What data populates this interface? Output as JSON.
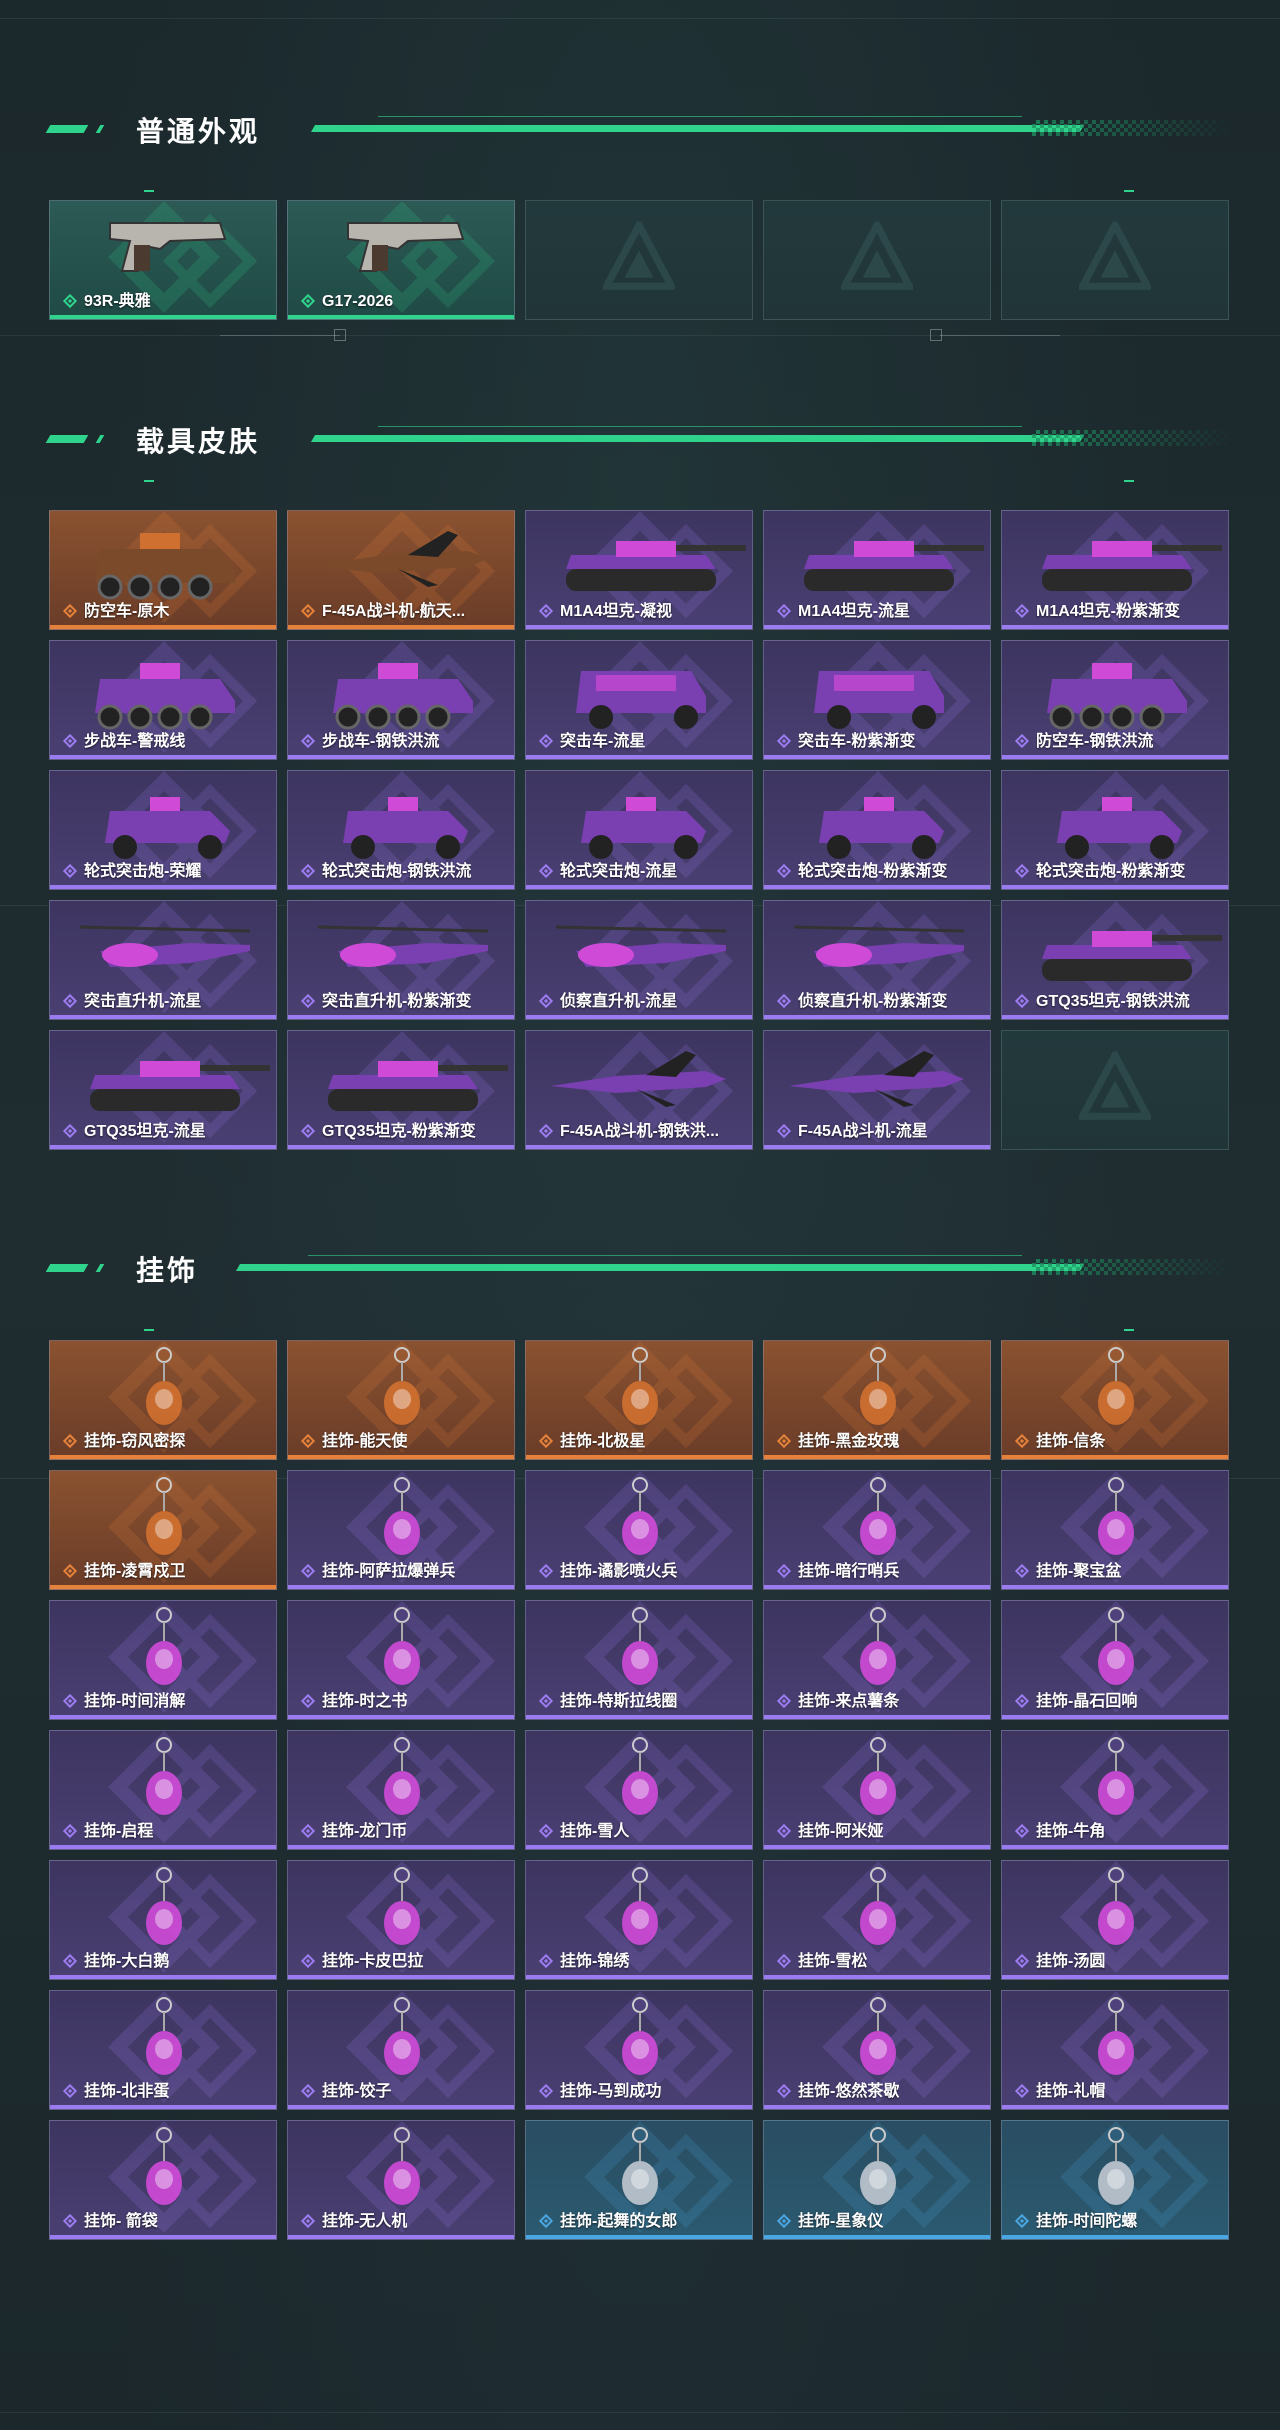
{
  "sections": {
    "normal": {
      "title": "普通外观"
    },
    "vehicle": {
      "title": "载具皮肤"
    },
    "charm": {
      "title": "挂饰"
    }
  },
  "rarity_colors": {
    "green": "#2fd38c",
    "orange": "#e5813a",
    "purple": "#9b7cf0",
    "blue": "#4aa6e0"
  },
  "normal_items": [
    {
      "label": "93R-典雅",
      "rarity": "green",
      "icon": "pistol-icon"
    },
    {
      "label": "G17-2026",
      "rarity": "green",
      "icon": "pistol-icon"
    },
    {
      "label": "",
      "rarity": "empty",
      "icon": "logo-watermark-icon"
    },
    {
      "label": "",
      "rarity": "empty",
      "icon": "logo-watermark-icon"
    },
    {
      "label": "",
      "rarity": "empty",
      "icon": "logo-watermark-icon"
    }
  ],
  "vehicle_items": [
    {
      "label": "防空车-原木",
      "rarity": "orange",
      "icon": "armored-car-icon"
    },
    {
      "label": "F-45A战斗机-航天...",
      "rarity": "orange",
      "icon": "jet-icon"
    },
    {
      "label": "M1A4坦克-凝视",
      "rarity": "purple",
      "icon": "tank-icon"
    },
    {
      "label": "M1A4坦克-流星",
      "rarity": "purple",
      "icon": "tank-icon"
    },
    {
      "label": "M1A4坦克-粉紫渐变",
      "rarity": "purple",
      "icon": "tank-icon"
    },
    {
      "label": "步战车-警戒线",
      "rarity": "purple",
      "icon": "armored-car-icon"
    },
    {
      "label": "步战车-钢铁洪流",
      "rarity": "purple",
      "icon": "armored-car-icon"
    },
    {
      "label": "突击车-流星",
      "rarity": "purple",
      "icon": "jeep-icon"
    },
    {
      "label": "突击车-粉紫渐变",
      "rarity": "purple",
      "icon": "jeep-icon"
    },
    {
      "label": "防空车-钢铁洪流",
      "rarity": "purple",
      "icon": "armored-car-icon"
    },
    {
      "label": "轮式突击炮-荣耀",
      "rarity": "purple",
      "icon": "buggy-icon"
    },
    {
      "label": "轮式突击炮-钢铁洪流",
      "rarity": "purple",
      "icon": "buggy-icon"
    },
    {
      "label": "轮式突击炮-流星",
      "rarity": "purple",
      "icon": "buggy-icon"
    },
    {
      "label": "轮式突击炮-粉紫渐变",
      "rarity": "purple",
      "icon": "buggy-icon"
    },
    {
      "label": "轮式突击炮-粉紫渐变",
      "rarity": "purple",
      "icon": "buggy-icon"
    },
    {
      "label": "突击直升机-流星",
      "rarity": "purple",
      "icon": "helicopter-icon"
    },
    {
      "label": "突击直升机-粉紫渐变",
      "rarity": "purple",
      "icon": "helicopter-icon"
    },
    {
      "label": "侦察直升机-流星",
      "rarity": "purple",
      "icon": "helicopter-icon"
    },
    {
      "label": "侦察直升机-粉紫渐变",
      "rarity": "purple",
      "icon": "helicopter-icon"
    },
    {
      "label": "GTQ35坦克-钢铁洪流",
      "rarity": "purple",
      "icon": "tank-icon"
    },
    {
      "label": "GTQ35坦克-流星",
      "rarity": "purple",
      "icon": "tank-icon"
    },
    {
      "label": "GTQ35坦克-粉紫渐变",
      "rarity": "purple",
      "icon": "tank-icon"
    },
    {
      "label": "F-45A战斗机-钢铁洪...",
      "rarity": "purple",
      "icon": "jet-icon"
    },
    {
      "label": "F-45A战斗机-流星",
      "rarity": "purple",
      "icon": "jet-icon"
    },
    {
      "label": "",
      "rarity": "empty",
      "icon": "logo-watermark-icon"
    }
  ],
  "charm_items": [
    {
      "label": "挂饰-窃风密探",
      "rarity": "orange",
      "icon": "charm-icon"
    },
    {
      "label": "挂饰-能天使",
      "rarity": "orange",
      "icon": "charm-icon"
    },
    {
      "label": "挂饰-北极星",
      "rarity": "orange",
      "icon": "charm-icon"
    },
    {
      "label": "挂饰-黑金玫瑰",
      "rarity": "orange",
      "icon": "charm-icon"
    },
    {
      "label": "挂饰-信条",
      "rarity": "orange",
      "icon": "charm-icon"
    },
    {
      "label": "挂饰-凌霄戍卫",
      "rarity": "orange",
      "icon": "charm-icon"
    },
    {
      "label": "挂饰-阿萨拉爆弹兵",
      "rarity": "purple",
      "icon": "charm-icon"
    },
    {
      "label": "挂饰-谲影喷火兵",
      "rarity": "purple",
      "icon": "charm-icon"
    },
    {
      "label": "挂饰-暗行哨兵",
      "rarity": "purple",
      "icon": "charm-icon"
    },
    {
      "label": "挂饰-聚宝盆",
      "rarity": "purple",
      "icon": "charm-icon"
    },
    {
      "label": "挂饰-时间消解",
      "rarity": "purple",
      "icon": "charm-icon"
    },
    {
      "label": "挂饰-时之书",
      "rarity": "purple",
      "icon": "charm-icon"
    },
    {
      "label": "挂饰-特斯拉线圈",
      "rarity": "purple",
      "icon": "charm-icon"
    },
    {
      "label": "挂饰-来点薯条",
      "rarity": "purple",
      "icon": "charm-icon"
    },
    {
      "label": "挂饰-晶石回响",
      "rarity": "purple",
      "icon": "charm-icon"
    },
    {
      "label": "挂饰-启程",
      "rarity": "purple",
      "icon": "charm-icon"
    },
    {
      "label": "挂饰-龙门币",
      "rarity": "purple",
      "icon": "charm-icon"
    },
    {
      "label": "挂饰-雪人",
      "rarity": "purple",
      "icon": "charm-icon"
    },
    {
      "label": "挂饰-阿米娅",
      "rarity": "purple",
      "icon": "charm-icon"
    },
    {
      "label": "挂饰-牛角",
      "rarity": "purple",
      "icon": "charm-icon"
    },
    {
      "label": "挂饰-大白鹅",
      "rarity": "purple",
      "icon": "charm-icon"
    },
    {
      "label": "挂饰-卡皮巴拉",
      "rarity": "purple",
      "icon": "charm-icon"
    },
    {
      "label": "挂饰-锦绣",
      "rarity": "purple",
      "icon": "charm-icon"
    },
    {
      "label": "挂饰-雪松",
      "rarity": "purple",
      "icon": "charm-icon"
    },
    {
      "label": "挂饰-汤圆",
      "rarity": "purple",
      "icon": "charm-icon"
    },
    {
      "label": "挂饰-北非蛋",
      "rarity": "purple",
      "icon": "charm-icon"
    },
    {
      "label": "挂饰-饺子",
      "rarity": "purple",
      "icon": "charm-icon"
    },
    {
      "label": "挂饰-马到成功",
      "rarity": "purple",
      "icon": "charm-icon"
    },
    {
      "label": "挂饰-悠然茶歇",
      "rarity": "purple",
      "icon": "charm-icon"
    },
    {
      "label": "挂饰-礼帽",
      "rarity": "purple",
      "icon": "charm-icon"
    },
    {
      "label": "挂饰- 箭袋",
      "rarity": "purple",
      "icon": "charm-icon"
    },
    {
      "label": "挂饰-无人机",
      "rarity": "purple",
      "icon": "charm-icon"
    },
    {
      "label": "挂饰-起舞的女郎",
      "rarity": "blue",
      "icon": "charm-icon"
    },
    {
      "label": "挂饰-星象仪",
      "rarity": "blue",
      "icon": "charm-icon"
    },
    {
      "label": "挂饰-时间陀螺",
      "rarity": "blue",
      "icon": "charm-icon"
    }
  ]
}
